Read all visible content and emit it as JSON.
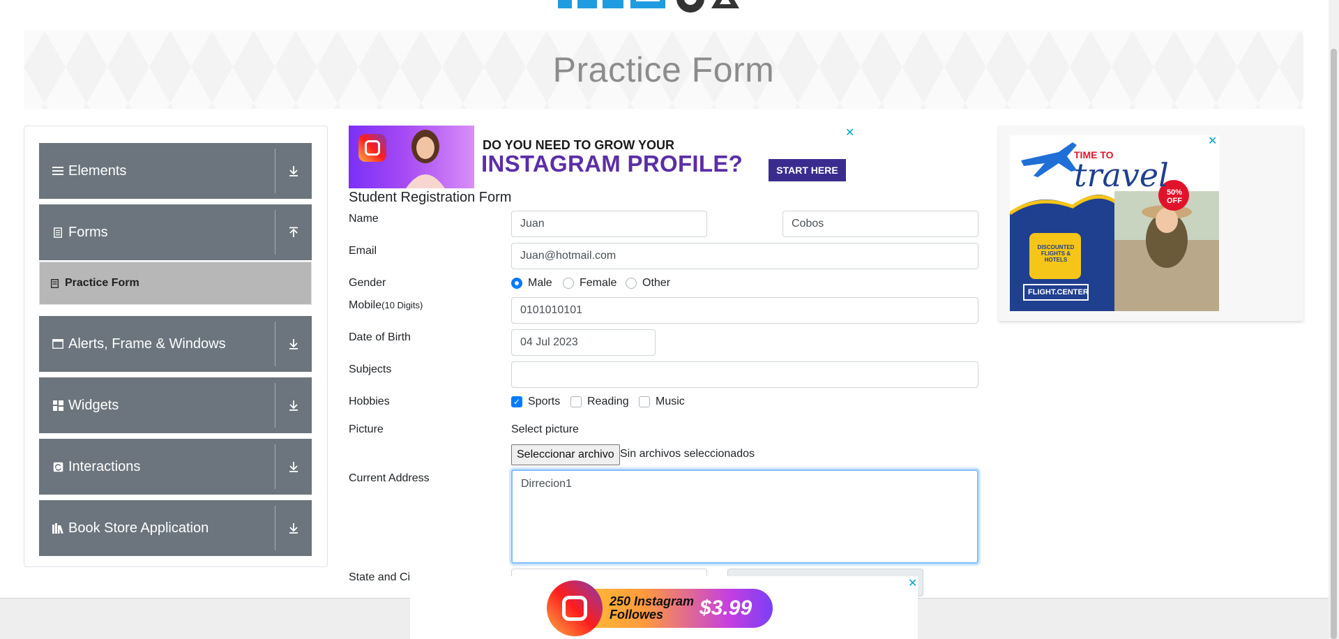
{
  "header": {
    "page_title": "Practice Form"
  },
  "sidebar": {
    "groups": [
      {
        "label": "Elements",
        "icon": "hamburger-icon",
        "arrow": "download-arrow-icon"
      },
      {
        "label": "Forms",
        "icon": "document-icon",
        "arrow": "upload-arrow-icon"
      },
      {
        "label": "Alerts, Frame & Windows",
        "icon": "window-icon",
        "arrow": "download-arrow-icon"
      },
      {
        "label": "Widgets",
        "icon": "grid-icon",
        "arrow": "download-arrow-icon"
      },
      {
        "label": "Interactions",
        "icon": "interaction-icon",
        "arrow": "download-arrow-icon"
      },
      {
        "label": "Book Store Application",
        "icon": "books-icon",
        "arrow": "download-arrow-icon"
      }
    ],
    "active_item": {
      "label": "Practice Form",
      "icon": "form-icon"
    }
  },
  "ads": {
    "top": {
      "line1": "DO YOU NEED TO GROW YOUR",
      "line2": "INSTAGRAM PROFILE?",
      "cta": "START HERE",
      "close": "✕"
    },
    "right": {
      "line1": "TIME TO",
      "line2": "travel",
      "badge": "50% OFF",
      "tag": "DISCOUNTED FLIGHTS & HOTELS",
      "brand": "FLIGHT.CENTER",
      "close": "✕"
    },
    "bottom": {
      "text1": "250 Instagram",
      "text2": "Followes",
      "price": "$3.99",
      "close": "✕"
    }
  },
  "form": {
    "title": "Student Registration Form",
    "name": {
      "label": "Name",
      "first": "Juan",
      "last": "Cobos"
    },
    "email": {
      "label": "Email",
      "value": "Juan@hotmail.com"
    },
    "gender": {
      "label": "Gender",
      "options": [
        "Male",
        "Female",
        "Other"
      ],
      "selected": "Male"
    },
    "mobile": {
      "label": "Mobile",
      "hint": "(10 Digits)",
      "value": "0101010101"
    },
    "dob": {
      "label": "Date of Birth",
      "value": "04 Jul 2023"
    },
    "subjects": {
      "label": "Subjects",
      "value": ""
    },
    "hobbies": {
      "label": "Hobbies",
      "options": [
        "Sports",
        "Reading",
        "Music"
      ],
      "checked": [
        "Sports"
      ]
    },
    "picture": {
      "label": "Picture",
      "prompt": "Select picture",
      "button": "Seleccionar archivo",
      "status": "Sin archivos seleccionados"
    },
    "address": {
      "label": "Current Address",
      "value": "Dirrecion1"
    },
    "state_city": {
      "label": "State and Ci"
    }
  },
  "colors": {
    "sidebar_group": "#6c757d",
    "accent": "#007bff",
    "active_item": "#b7b7b7"
  }
}
